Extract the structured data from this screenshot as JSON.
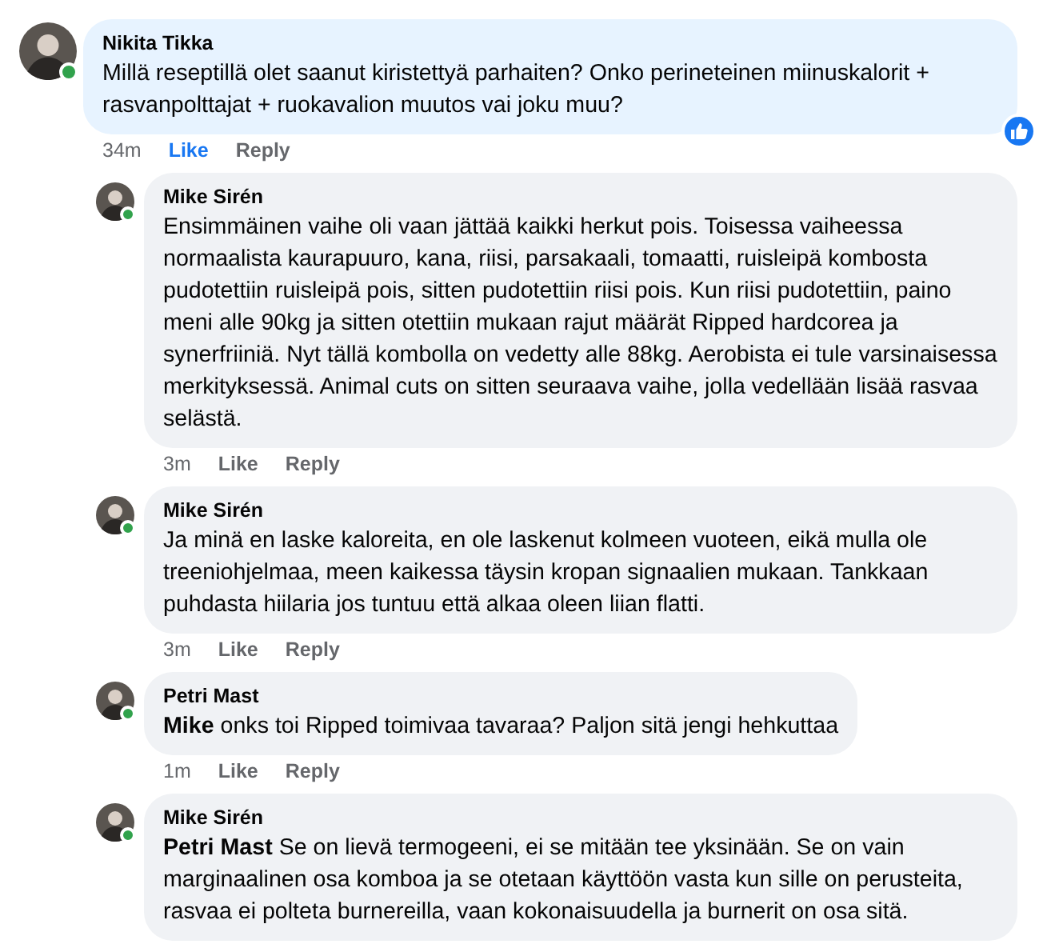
{
  "comment": {
    "author": "Nikita Tikka",
    "online": true,
    "text": "Millä reseptillä olet saanut kiristettyä parhaiten? Onko perineteinen miinuskalorit + rasvanpolttajat + ruokavalion muutos vai joku muu?",
    "time": "34m",
    "like": {
      "label": "Like",
      "selected": true
    },
    "reply": "Reply",
    "reacted": true,
    "replies": [
      {
        "author": "Mike Sirén",
        "online": true,
        "text": "Ensimmäinen vaihe oli vaan jättää kaikki herkut pois. Toisessa vaiheessa normaalista kaurapuuro, kana, riisi, parsakaali, tomaatti, ruisleipä kombosta pudotettiin ruisleipä pois, sitten pudotettiin riisi pois. Kun riisi pudotettiin, paino meni alle 90kg ja sitten otettiin mukaan rajut määrät Ripped hardcorea ja synerfriiniä. Nyt tällä kombolla on vedetty alle 88kg. Aerobista ei tule varsinaisessa merkityksessä. Animal cuts on sitten seuraava vaihe, jolla vedellään lisää rasvaa selästä.",
        "time": "3m",
        "like": {
          "label": "Like",
          "selected": false
        },
        "reply": "Reply"
      },
      {
        "author": "Mike Sirén",
        "online": true,
        "text": "Ja minä en laske kaloreita, en ole laskenut kolmeen vuoteen, eikä mulla ole treeniohjelmaa, meen kaikessa täysin kropan signaalien mukaan. Tankkaan puhdasta hiilaria jos tuntuu että alkaa oleen liian flatti.",
        "time": "3m",
        "like": {
          "label": "Like",
          "selected": false
        },
        "reply": "Reply"
      },
      {
        "author": "Petri Mast",
        "online": true,
        "text": "**Mike** onks toi Ripped toimivaa tavaraa? Paljon sitä jengi hehkuttaa",
        "time": "1m",
        "like": {
          "label": "Like",
          "selected": false
        },
        "reply": "Reply"
      },
      {
        "author": "Mike Sirén",
        "online": true,
        "text": "**Petri Mast** Se on lievä termogeeni, ei se mitään tee yksinään. Se on vain marginaalinen osa komboa ja se otetaan käyttöön vasta kun sille on perusteita, rasvaa ei polteta burnereilla, vaan kokonaisuudella ja burnerit on osa sitä."
      }
    ]
  }
}
